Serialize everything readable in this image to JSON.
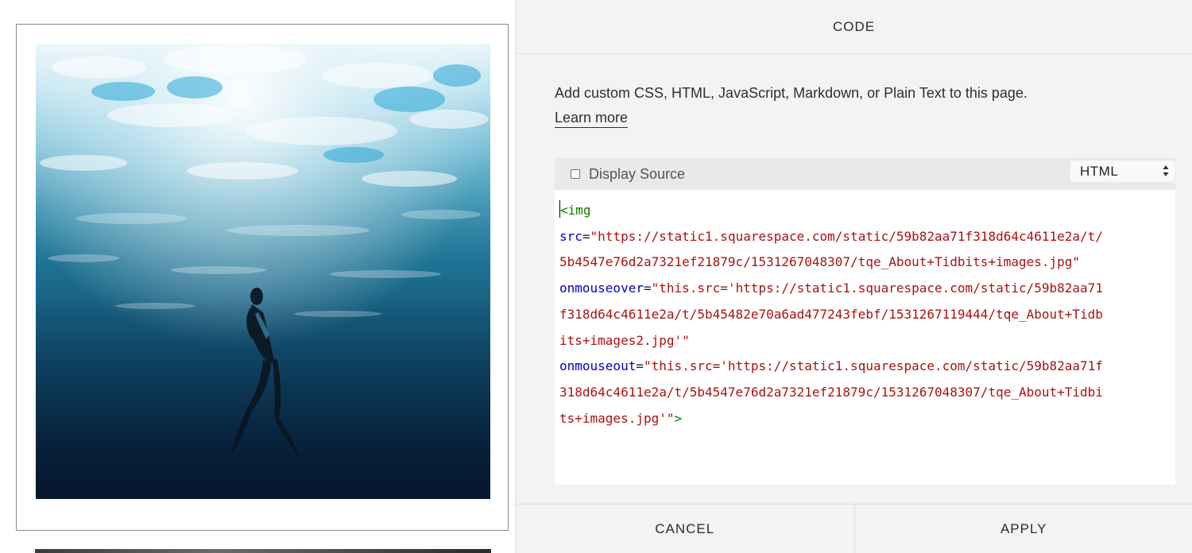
{
  "panel": {
    "title": "CODE",
    "description": "Add custom CSS, HTML, JavaScript, Markdown, or Plain Text to this page.",
    "learn_more": "Learn more"
  },
  "editor": {
    "display_source_label": "Display Source",
    "display_source_checked": false,
    "language": "HTML",
    "code_lines": [
      [
        {
          "t": "tag",
          "v": "<img"
        }
      ],
      [
        {
          "t": "attr",
          "v": "src"
        },
        {
          "t": "punct",
          "v": "="
        },
        {
          "t": "str",
          "v": "\"https://static1.squarespace.com/static/59b82aa71f318d64c4611e2a/t/"
        }
      ],
      [
        {
          "t": "str",
          "v": "5b4547e76d2a7321ef21879c/1531267048307/tqe_About+Tidbits+images.jpg\""
        }
      ],
      [
        {
          "t": "attr",
          "v": "onmouseover"
        },
        {
          "t": "punct",
          "v": "="
        },
        {
          "t": "str",
          "v": "\"this.src='https://static1.squarespace.com/static/59b82aa71"
        }
      ],
      [
        {
          "t": "str",
          "v": "f318d64c4611e2a/t/5b45482e70a6ad477243febf/1531267119444/tqe_About+Tidb"
        }
      ],
      [
        {
          "t": "str",
          "v": "its+images2.jpg'\""
        }
      ],
      [
        {
          "t": "attr",
          "v": "onmouseout"
        },
        {
          "t": "punct",
          "v": "="
        },
        {
          "t": "str",
          "v": "\"this.src='https://static1.squarespace.com/static/59b82aa71f"
        }
      ],
      [
        {
          "t": "str",
          "v": "318d64c4611e2a/t/5b4547e76d2a7321ef21879c/1531267048307/tqe_About+Tidbi"
        }
      ],
      [
        {
          "t": "str",
          "v": "ts+images.jpg'\""
        },
        {
          "t": "tag",
          "v": ">"
        }
      ]
    ]
  },
  "footer": {
    "cancel_label": "CANCEL",
    "apply_label": "APPLY"
  },
  "colors": {
    "panel_bg": "#f3f3f3",
    "toolbar_bg": "#e9e9e9",
    "code_tag": "#117700",
    "code_attr": "#0000cc",
    "code_string": "#aa1111"
  }
}
